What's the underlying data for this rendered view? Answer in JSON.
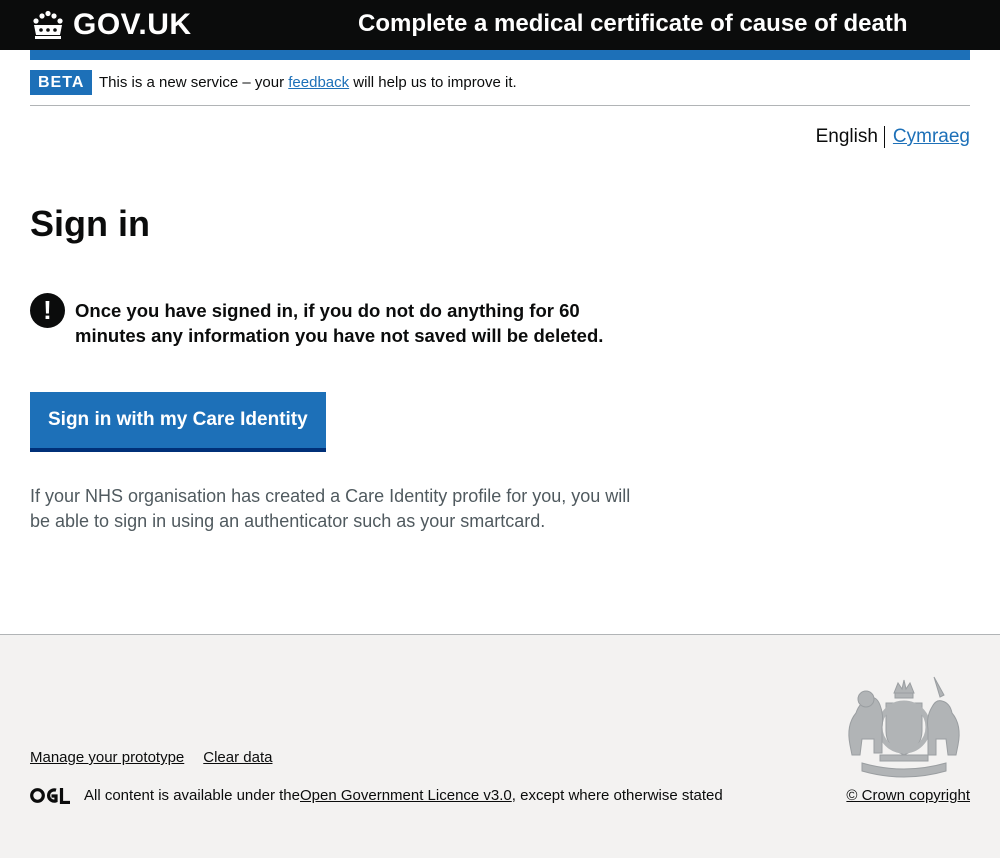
{
  "header": {
    "logo_text": "GOV.UK",
    "service_name": "Complete a medical certificate of cause of death"
  },
  "phase_banner": {
    "tag": "BETA",
    "text_before": "This is a new service – your ",
    "link_text": "feedback",
    "text_after": " will help us to improve it."
  },
  "language": {
    "current": "English",
    "other": "Cymraeg"
  },
  "main": {
    "title": "Sign in",
    "warning_icon": "!",
    "warning_text": "Once you have signed in, if you do not do anything for 60 minutes any information you have not saved will be deleted.",
    "button_label": "Sign in with my Care Identity",
    "hint": "If your NHS organisation has created a Care Identity profile for you, you will be able to sign in using an authenticator such as your smartcard."
  },
  "footer": {
    "links": [
      "Manage your prototype",
      "Clear data"
    ],
    "licence_before": "All content is available under the ",
    "licence_link": "Open Government Licence v3.0",
    "licence_after": ", except where otherwise stated",
    "copyright": "© Crown copyright"
  },
  "colors": {
    "header_bg": "#0b0c0c",
    "brand_blue": "#1d70b8",
    "footer_bg": "#f3f2f1",
    "text": "#0b0c0c",
    "secondary_text": "#505a5f"
  },
  "icons": [
    "crown-icon",
    "warning-icon",
    "ogl-logo-icon",
    "royal-coat-of-arms-icon"
  ]
}
